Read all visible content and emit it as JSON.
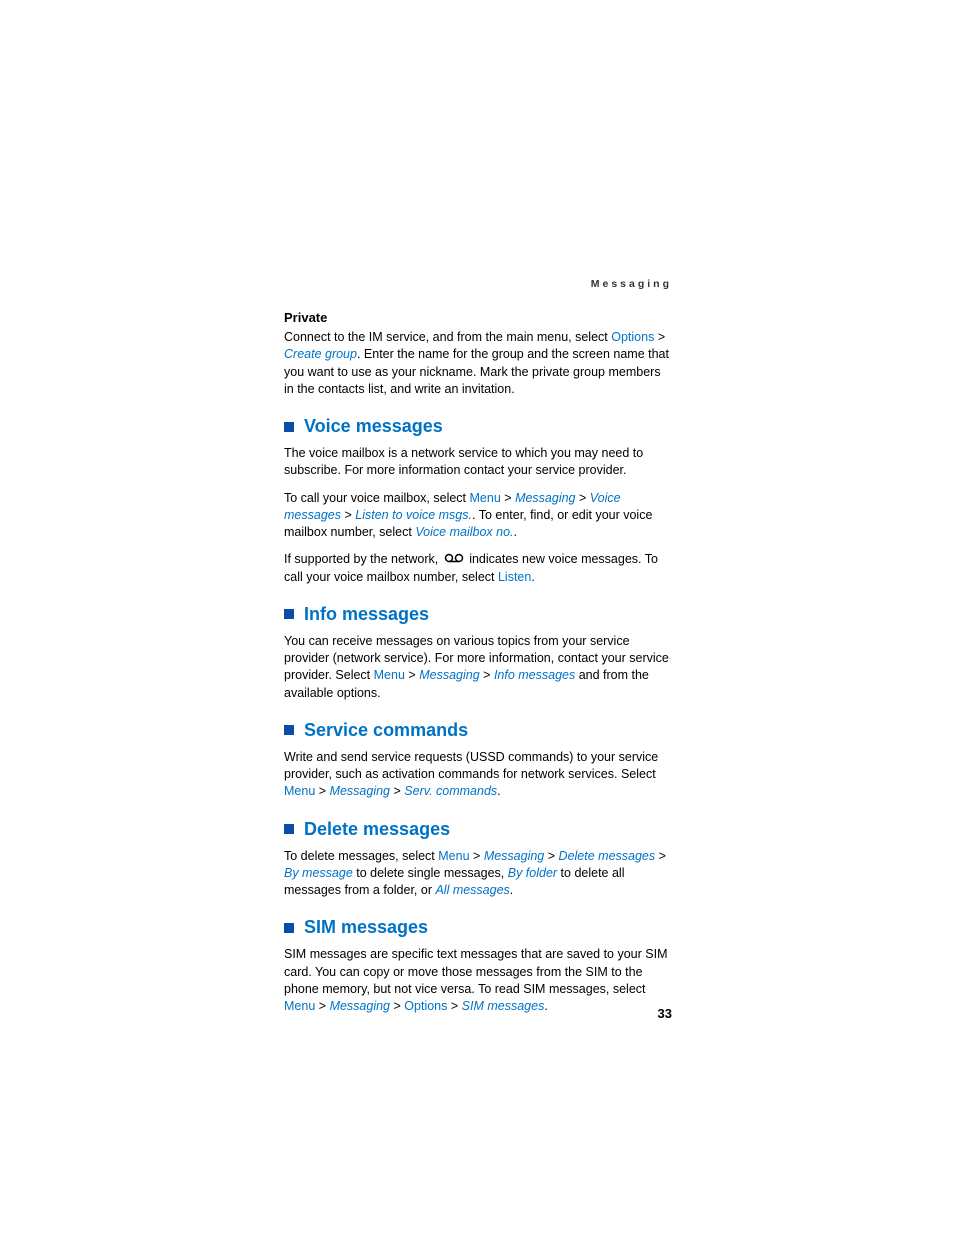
{
  "header": {
    "running": "Messaging"
  },
  "private": {
    "title": "Private",
    "p1a": "Connect to the IM service, and from the main menu, select ",
    "options": "Options",
    "create_group": "Create group",
    "p1b": ". Enter the name for the group and the screen name that you want to use as your nickname. Mark the private group members in the contacts list, and write an invitation."
  },
  "voice": {
    "title": "Voice messages",
    "p1": "The voice mailbox is a network service to which you may need to subscribe. For more information contact your service provider.",
    "p2a": "To call your voice mailbox, select ",
    "menu": "Menu",
    "messaging": "Messaging",
    "voice_messages": "Voice messages",
    "listen": "Listen to voice msgs.",
    "p2b": ". To enter, find, or edit your voice mailbox number, select ",
    "mailbox_no": "Voice mailbox no.",
    "p2c": ".",
    "p3a": "If supported by the network, ",
    "p3b": " indicates new voice messages. To call your voice mailbox number, select ",
    "listen_btn": "Listen",
    "p3c": "."
  },
  "info": {
    "title": "Info messages",
    "p1a": "You can receive messages on various topics from your service provider (network service). For more information, contact your service provider. Select ",
    "menu": "Menu",
    "messaging": "Messaging",
    "info_messages": "Info messages",
    "p1b": " and from the available options."
  },
  "service": {
    "title": "Service commands",
    "p1a": "Write and send service requests (USSD commands) to your service provider, such as activation commands for network services. Select ",
    "menu": "Menu",
    "messaging": "Messaging",
    "serv": "Serv. commands",
    "p1b": "."
  },
  "delete": {
    "title": "Delete messages",
    "p1a": "To delete messages, select ",
    "menu": "Menu",
    "messaging": "Messaging",
    "delete_msgs": "Delete messages",
    "by_message": "By message",
    "p1b": " to delete single messages, ",
    "by_folder": "By folder",
    "p1c": " to delete all messages from a folder, or ",
    "all": "All messages",
    "p1d": "."
  },
  "sim": {
    "title": "SIM messages",
    "p1a": "SIM messages are specific text messages that are saved to your SIM card. You can copy or move those messages from the SIM to the phone memory, but not vice versa. To read SIM messages, select ",
    "menu": "Menu",
    "messaging": "Messaging",
    "options": "Options",
    "sim_msgs": "SIM messages",
    "p1b": "."
  },
  "page_number": "33",
  "gt": ">"
}
